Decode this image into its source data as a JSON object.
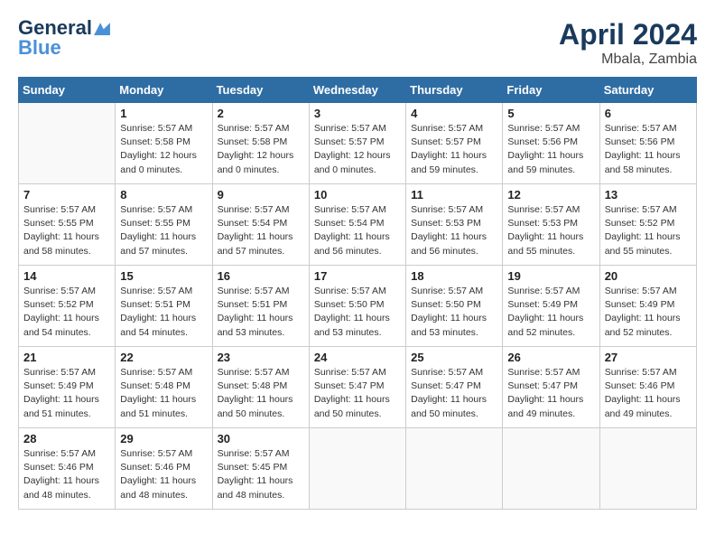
{
  "header": {
    "logo_line1": "General",
    "logo_line2": "Blue",
    "month": "April 2024",
    "location": "Mbala, Zambia"
  },
  "days_of_week": [
    "Sunday",
    "Monday",
    "Tuesday",
    "Wednesday",
    "Thursday",
    "Friday",
    "Saturday"
  ],
  "weeks": [
    [
      {
        "day": "",
        "info": ""
      },
      {
        "day": "1",
        "info": "Sunrise: 5:57 AM\nSunset: 5:58 PM\nDaylight: 12 hours\nand 0 minutes."
      },
      {
        "day": "2",
        "info": "Sunrise: 5:57 AM\nSunset: 5:58 PM\nDaylight: 12 hours\nand 0 minutes."
      },
      {
        "day": "3",
        "info": "Sunrise: 5:57 AM\nSunset: 5:57 PM\nDaylight: 12 hours\nand 0 minutes."
      },
      {
        "day": "4",
        "info": "Sunrise: 5:57 AM\nSunset: 5:57 PM\nDaylight: 11 hours\nand 59 minutes."
      },
      {
        "day": "5",
        "info": "Sunrise: 5:57 AM\nSunset: 5:56 PM\nDaylight: 11 hours\nand 59 minutes."
      },
      {
        "day": "6",
        "info": "Sunrise: 5:57 AM\nSunset: 5:56 PM\nDaylight: 11 hours\nand 58 minutes."
      }
    ],
    [
      {
        "day": "7",
        "info": "Sunrise: 5:57 AM\nSunset: 5:55 PM\nDaylight: 11 hours\nand 58 minutes."
      },
      {
        "day": "8",
        "info": "Sunrise: 5:57 AM\nSunset: 5:55 PM\nDaylight: 11 hours\nand 57 minutes."
      },
      {
        "day": "9",
        "info": "Sunrise: 5:57 AM\nSunset: 5:54 PM\nDaylight: 11 hours\nand 57 minutes."
      },
      {
        "day": "10",
        "info": "Sunrise: 5:57 AM\nSunset: 5:54 PM\nDaylight: 11 hours\nand 56 minutes."
      },
      {
        "day": "11",
        "info": "Sunrise: 5:57 AM\nSunset: 5:53 PM\nDaylight: 11 hours\nand 56 minutes."
      },
      {
        "day": "12",
        "info": "Sunrise: 5:57 AM\nSunset: 5:53 PM\nDaylight: 11 hours\nand 55 minutes."
      },
      {
        "day": "13",
        "info": "Sunrise: 5:57 AM\nSunset: 5:52 PM\nDaylight: 11 hours\nand 55 minutes."
      }
    ],
    [
      {
        "day": "14",
        "info": "Sunrise: 5:57 AM\nSunset: 5:52 PM\nDaylight: 11 hours\nand 54 minutes."
      },
      {
        "day": "15",
        "info": "Sunrise: 5:57 AM\nSunset: 5:51 PM\nDaylight: 11 hours\nand 54 minutes."
      },
      {
        "day": "16",
        "info": "Sunrise: 5:57 AM\nSunset: 5:51 PM\nDaylight: 11 hours\nand 53 minutes."
      },
      {
        "day": "17",
        "info": "Sunrise: 5:57 AM\nSunset: 5:50 PM\nDaylight: 11 hours\nand 53 minutes."
      },
      {
        "day": "18",
        "info": "Sunrise: 5:57 AM\nSunset: 5:50 PM\nDaylight: 11 hours\nand 53 minutes."
      },
      {
        "day": "19",
        "info": "Sunrise: 5:57 AM\nSunset: 5:49 PM\nDaylight: 11 hours\nand 52 minutes."
      },
      {
        "day": "20",
        "info": "Sunrise: 5:57 AM\nSunset: 5:49 PM\nDaylight: 11 hours\nand 52 minutes."
      }
    ],
    [
      {
        "day": "21",
        "info": "Sunrise: 5:57 AM\nSunset: 5:49 PM\nDaylight: 11 hours\nand 51 minutes."
      },
      {
        "day": "22",
        "info": "Sunrise: 5:57 AM\nSunset: 5:48 PM\nDaylight: 11 hours\nand 51 minutes."
      },
      {
        "day": "23",
        "info": "Sunrise: 5:57 AM\nSunset: 5:48 PM\nDaylight: 11 hours\nand 50 minutes."
      },
      {
        "day": "24",
        "info": "Sunrise: 5:57 AM\nSunset: 5:47 PM\nDaylight: 11 hours\nand 50 minutes."
      },
      {
        "day": "25",
        "info": "Sunrise: 5:57 AM\nSunset: 5:47 PM\nDaylight: 11 hours\nand 50 minutes."
      },
      {
        "day": "26",
        "info": "Sunrise: 5:57 AM\nSunset: 5:47 PM\nDaylight: 11 hours\nand 49 minutes."
      },
      {
        "day": "27",
        "info": "Sunrise: 5:57 AM\nSunset: 5:46 PM\nDaylight: 11 hours\nand 49 minutes."
      }
    ],
    [
      {
        "day": "28",
        "info": "Sunrise: 5:57 AM\nSunset: 5:46 PM\nDaylight: 11 hours\nand 48 minutes."
      },
      {
        "day": "29",
        "info": "Sunrise: 5:57 AM\nSunset: 5:46 PM\nDaylight: 11 hours\nand 48 minutes."
      },
      {
        "day": "30",
        "info": "Sunrise: 5:57 AM\nSunset: 5:45 PM\nDaylight: 11 hours\nand 48 minutes."
      },
      {
        "day": "",
        "info": ""
      },
      {
        "day": "",
        "info": ""
      },
      {
        "day": "",
        "info": ""
      },
      {
        "day": "",
        "info": ""
      }
    ]
  ]
}
